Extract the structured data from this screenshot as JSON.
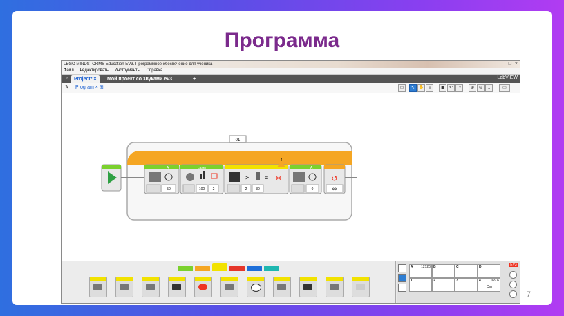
{
  "slide": {
    "title": "Программа",
    "page_number": "7"
  },
  "app": {
    "window_title": "LEGO MINDSTORMS Education EV3. Программное обеспечение для ученика",
    "menu": [
      "Файл",
      "Редактировать",
      "Инструменты",
      "Справка"
    ],
    "tabs": [
      {
        "label": "Project*",
        "active": true
      },
      {
        "label": "Мой проект со звуками.ev3",
        "active": false
      }
    ],
    "brand": "LabVIEW",
    "program_tab": "Program",
    "loop": {
      "label": "01"
    },
    "blocks": {
      "move1": {
        "port": "A",
        "value": "50"
      },
      "laser": {
        "header": "Laser",
        "value1": "100",
        "value2": "2"
      },
      "wait": {
        "port": "4",
        "op": ">",
        "eq": "=",
        "value1": "2",
        "value2": "30"
      },
      "move2": {
        "port": "A",
        "value": "0"
      },
      "loop_end": {
        "symbol": "∞"
      }
    },
    "palette_colors": [
      "#7bd12e",
      "#f5a623",
      "#f2e200",
      "#e5362a",
      "#1e6fd9",
      "#1fb7b0"
    ],
    "hardware": {
      "ports": [
        {
          "id": "A",
          "value": "12120"
        },
        {
          "id": "B",
          "value": ""
        },
        {
          "id": "C",
          "value": ""
        },
        {
          "id": "D",
          "value": ""
        },
        {
          "id": "1",
          "value": ""
        },
        {
          "id": "2",
          "value": ""
        },
        {
          "id": "3",
          "value": ""
        },
        {
          "id": "4",
          "value": "169.6"
        }
      ],
      "brick": "EV3",
      "unit": "Cm"
    }
  }
}
